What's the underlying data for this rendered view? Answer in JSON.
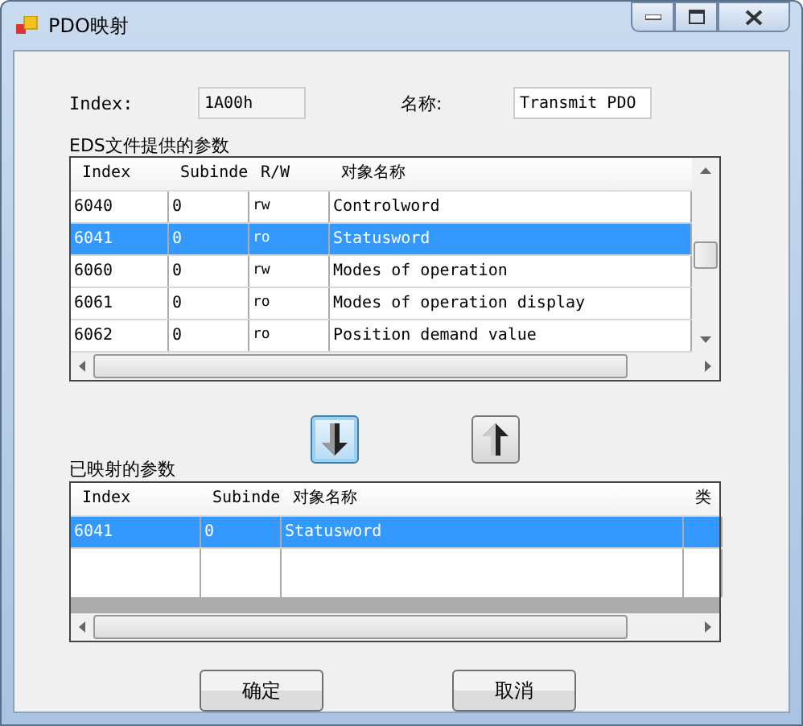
{
  "window": {
    "title": "PDO映射"
  },
  "index_field": {
    "label": "Index:",
    "value": "1A00h"
  },
  "name_field": {
    "label": "名称:",
    "value": "Transmit PDO"
  },
  "eds_table": {
    "title": "EDS文件提供的参数",
    "columns": [
      "Index",
      "Subinde",
      "R/W",
      "对象名称"
    ],
    "rows": [
      {
        "cells": [
          "6040",
          "0",
          "rw",
          "Controlword"
        ],
        "selected": false
      },
      {
        "cells": [
          "6041",
          "0",
          "ro",
          "Statusword"
        ],
        "selected": true
      },
      {
        "cells": [
          "6060",
          "0",
          "rw",
          "Modes of operation"
        ],
        "selected": false
      },
      {
        "cells": [
          "6061",
          "0",
          "ro",
          "Modes of operation display"
        ],
        "selected": false
      },
      {
        "cells": [
          "6062",
          "0",
          "ro",
          "Position demand value"
        ],
        "selected": false
      }
    ]
  },
  "mapped_table": {
    "title": "已映射的参数",
    "columns": [
      "Index",
      "Subinde",
      "对象名称",
      "类"
    ],
    "rows": [
      {
        "cells": [
          "6041",
          "0",
          "Statusword",
          ""
        ],
        "selected": true
      }
    ]
  },
  "buttons": [
    "确定",
    "取消"
  ]
}
